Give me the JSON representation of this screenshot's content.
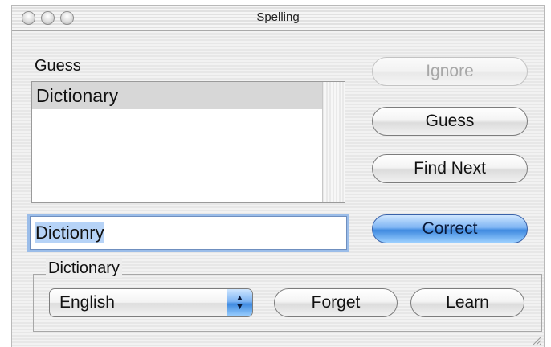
{
  "window": {
    "title": "Spelling"
  },
  "guess_section": {
    "label": "Guess",
    "items": [
      "Dictionary"
    ]
  },
  "word_field": {
    "value": "Dictionry"
  },
  "buttons": {
    "ignore": "Ignore",
    "guess": "Guess",
    "find_next": "Find Next",
    "correct": "Correct",
    "forget": "Forget",
    "learn": "Learn"
  },
  "dictionary_group": {
    "label": "Dictionary",
    "language_selected": "English"
  },
  "colors": {
    "default_button": "#3f8ae0",
    "selection": "#b6d3f7"
  }
}
